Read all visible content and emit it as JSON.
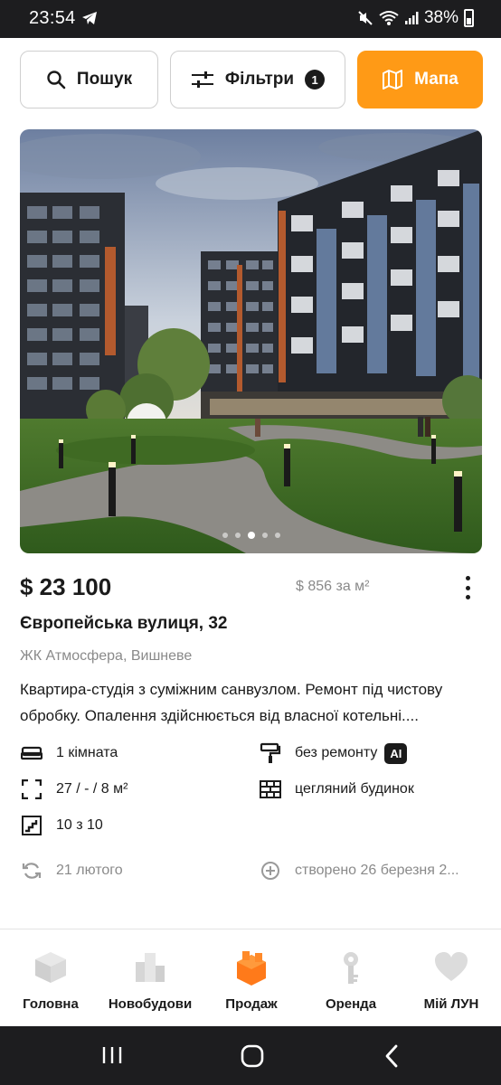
{
  "status_bar": {
    "time": "23:54",
    "battery": "38%"
  },
  "actions": {
    "search_label": "Пошук",
    "filters_label": "Фільтри",
    "filters_count": "1",
    "map_label": "Мапа"
  },
  "listing": {
    "price": "$ 23 100",
    "price_per_m2": "$ 856 за м²",
    "address": "Європейська вулиця, 32",
    "complex": "ЖК Атмосфера, Вишневе",
    "description": "Квартира-студія з суміжним санвузлом. Ремонт під чистову обробку. Опалення здійснюється від власної котельні....",
    "rooms": "1 кімната",
    "area": "27 / - / 8 м²",
    "floor": "10 з 10",
    "renovation": "без ремонту",
    "ai_badge": "AI",
    "building": "цегляний будинок",
    "updated": "21 лютого",
    "created": "створено 26 березня 2..."
  },
  "photo": {
    "slide_count": 5,
    "active_slide": 3
  },
  "bottom_nav": [
    {
      "label": "Головна",
      "icon": "cube-icon"
    },
    {
      "label": "Новобудови",
      "icon": "buildings-icon"
    },
    {
      "label": "Продаж",
      "icon": "orange-blocks-icon",
      "active": true
    },
    {
      "label": "Оренда",
      "icon": "key-icon"
    },
    {
      "label": "Мій ЛУН",
      "icon": "heart-icon"
    }
  ],
  "colors": {
    "accent": "#ff9a16",
    "text": "#1b1b1b",
    "muted": "#8a8a8a"
  }
}
